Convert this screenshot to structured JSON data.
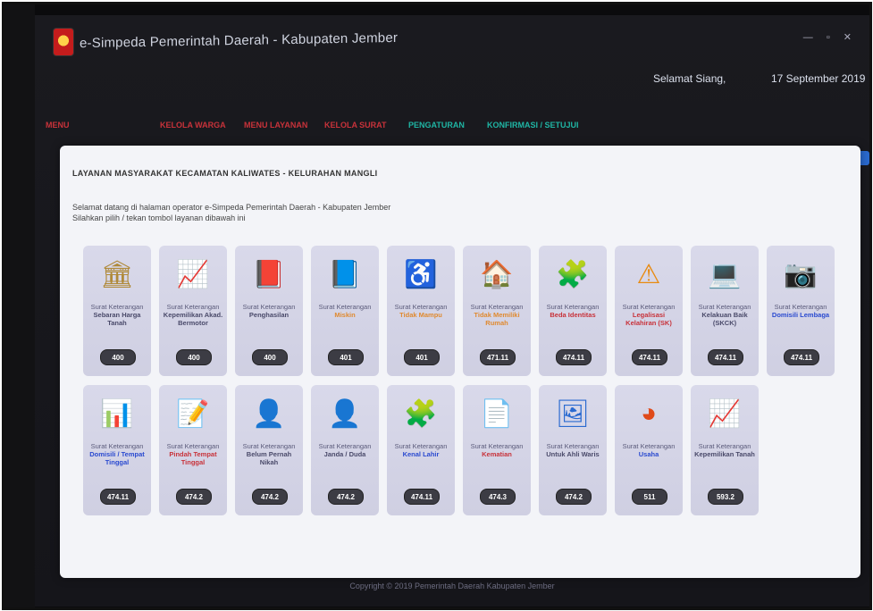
{
  "header": {
    "title": "e-Simpeda Pemerintah Daerah - Kabupaten Jember",
    "greeting": "Selamat Siang,",
    "date": "17 September 2019",
    "win_controls": "— ▫ ✕"
  },
  "nav": [
    {
      "label": "MENU",
      "color": "#c8323a"
    },
    {
      "label": "KELOLA WARGA",
      "color": "#c8323a"
    },
    {
      "label": "MENU LAYANAN",
      "color": "#c8323a"
    },
    {
      "label": "KELOLA SURAT",
      "color": "#c8323a"
    },
    {
      "label": "PENGATURAN",
      "color": "#1fb5a4"
    },
    {
      "label": "KONFIRMASI / SETUJUI",
      "color": "#1fb5a4"
    }
  ],
  "panel": {
    "header": "LAYANAN MASYARAKAT KECAMATAN KALIWATES - KELURAHAN MANGLI",
    "desc1": "Selamat datang di halaman operator e-Simpeda Pemerintah Daerah - Kabupaten Jember",
    "desc2": "Silahkan pilih / tekan tombol layanan dibawah ini"
  },
  "tiles": [
    {
      "icon": "house-document-icon",
      "glyph": "🏛",
      "c1": "#b08a3a",
      "l1": "Surat Keterangan",
      "l2": "Sebaran Harga Tanah",
      "l2color": "#4a4a6a",
      "badge": "400"
    },
    {
      "icon": "check-document-icon",
      "glyph": "📈",
      "c1": "#9aa",
      "l1": "Surat Keterangan",
      "l2": "Kepemilikan Akad. Bermotor",
      "l2color": "#4a4a6a",
      "badge": "400"
    },
    {
      "icon": "red-book-icon",
      "glyph": "📕",
      "c1": "#c22",
      "l1": "Surat Keterangan",
      "l2": "Penghasilan",
      "l2color": "#4a4a6a",
      "badge": "400"
    },
    {
      "icon": "blue-book-icon",
      "glyph": "📘",
      "c1": "#25a",
      "l1": "Surat Keterangan",
      "l2": "Miskin",
      "l2color": "#e08a30",
      "badge": "401"
    },
    {
      "icon": "wheelchair-icon",
      "glyph": "♿",
      "c1": "#2a6ad0",
      "l1": "Surat Keterangan",
      "l2": "Tidak Mampu",
      "l2color": "#e08a30",
      "badge": "401"
    },
    {
      "icon": "house-icon",
      "glyph": "🏠",
      "c1": "#777",
      "l1": "Surat Keterangan",
      "l2": "Tidak Memiliki Rumah",
      "l2color": "#e08a30",
      "badge": "471.11"
    },
    {
      "icon": "puzzle-icon",
      "glyph": "🧩",
      "c1": "#2a6ad0",
      "l1": "Surat Keterangan",
      "l2": "Beda Identitas",
      "l2color": "#c8323a",
      "badge": "474.11"
    },
    {
      "icon": "warning-icon",
      "glyph": "⚠",
      "c1": "#e88a10",
      "l1": "Surat Keterangan",
      "l2": "Legalisasi Kelahiran (SK)",
      "l2color": "#c8323a",
      "badge": "474.11"
    },
    {
      "icon": "laptop-icon",
      "glyph": "💻",
      "c1": "#2a9a3a",
      "l1": "Surat Keterangan",
      "l2": "Kelakuan Baik (SKCK)",
      "l2color": "#4a4a6a",
      "badge": "474.11"
    },
    {
      "icon": "webcam-icon",
      "glyph": "📷",
      "c1": "#333",
      "l1": "Surat Keterangan",
      "l2": "Domisili Lembaga",
      "l2color": "#2a4ad0",
      "badge": "474.11"
    },
    {
      "icon": "bar-chart-icon",
      "glyph": "📊",
      "c1": "#e05a20",
      "l1": "Surat Keterangan",
      "l2": "Domisili / Tempat Tinggal",
      "l2color": "#2a4ad0",
      "badge": "474.11"
    },
    {
      "icon": "checklist-icon",
      "glyph": "📝",
      "c1": "#888",
      "l1": "Surat Keterangan",
      "l2": "Pindah Tempat Tinggal",
      "l2color": "#c8323a",
      "badge": "474.2"
    },
    {
      "icon": "person-icon",
      "glyph": "👤",
      "c1": "#2a6ad0",
      "l1": "Surat Keterangan",
      "l2": "Belum Pernah Nikah",
      "l2color": "#4a4a6a",
      "badge": "474.2"
    },
    {
      "icon": "person-icon",
      "glyph": "👤",
      "c1": "#2a6ad0",
      "l1": "Surat Keterangan",
      "l2": "Janda / Duda",
      "l2color": "#4a4a6a",
      "badge": "474.2"
    },
    {
      "icon": "puzzle-pieces-icon",
      "glyph": "🧩",
      "c1": "#2aa04a",
      "l1": "Surat Keterangan",
      "l2": "Kenal Lahir",
      "l2color": "#2a4ad0",
      "badge": "474.11"
    },
    {
      "icon": "document-icon",
      "glyph": "📄",
      "c1": "#aab",
      "l1": "Surat Keterangan",
      "l2": "Kematian",
      "l2color": "#c8323a",
      "badge": "474.3"
    },
    {
      "icon": "certificate-icon",
      "glyph": "🖼",
      "c1": "#2a6ad0",
      "l1": "Surat Keterangan",
      "l2": "Untuk Ahli Waris",
      "l2color": "#4a4a6a",
      "badge": "474.2"
    },
    {
      "icon": "pie-chart-icon",
      "glyph": "◕",
      "c1": "#e04a1a",
      "l1": "Surat Keterangan",
      "l2": "Usaha",
      "l2color": "#2a4ad0",
      "badge": "511"
    },
    {
      "icon": "chart-document-icon",
      "glyph": "📈",
      "c1": "#9aa",
      "l1": "Surat Keterangan",
      "l2": "Kepemilikan Tanah",
      "l2color": "#4a4a6a",
      "badge": "593.2"
    }
  ],
  "footer": "Copyright © 2019 Pemerintah Daerah Kabupaten Jember"
}
